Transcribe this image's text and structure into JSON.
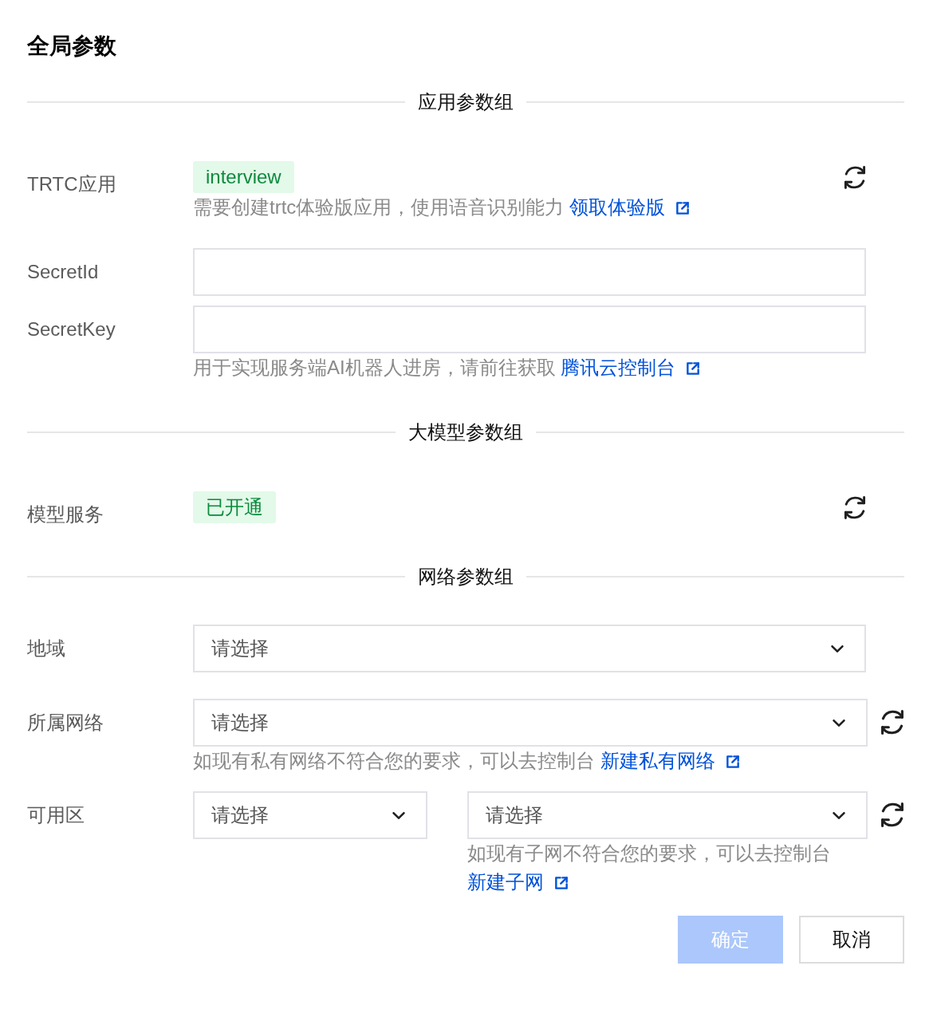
{
  "title": "全局参数",
  "sections": [
    {
      "title": "应用参数组",
      "fields": [
        {
          "kind": "tag",
          "label": "TRTC应用",
          "tag": "interview",
          "refresh": true,
          "help": {
            "text": "需要创建trtc体验版应用，使用语音识别能力",
            "link": "领取体验版"
          }
        },
        {
          "kind": "input",
          "label": "SecretId",
          "refresh": false
        },
        {
          "kind": "input",
          "label": "SecretKey",
          "refresh": false,
          "help": {
            "text": "用于实现服务端AI机器人进房，请前往获取",
            "link": "腾讯云控制台"
          }
        }
      ]
    },
    {
      "title": "大模型参数组",
      "fields": [
        {
          "kind": "tag",
          "label": "模型服务",
          "tag": "已开通",
          "refresh": true
        }
      ]
    },
    {
      "title": "网络参数组",
      "fields": [
        {
          "kind": "select",
          "label": "地域",
          "selects": [
            {
              "placeholder": "请选择"
            }
          ],
          "refresh": false
        },
        {
          "kind": "select",
          "label": "所属网络",
          "selects": [
            {
              "placeholder": "请选择"
            }
          ],
          "refresh": true,
          "help": {
            "text": "如现有私有网络不符合您的要求，可以去控制台",
            "link": "新建私有网络"
          }
        },
        {
          "kind": "select",
          "label": "可用区",
          "selects": [
            {
              "placeholder": "请选择"
            },
            {
              "placeholder": "请选择"
            }
          ],
          "refresh": true,
          "help": {
            "text": "如现有子网不符合您的要求，可以去控制台",
            "link": "新建子网"
          }
        }
      ]
    }
  ],
  "buttons": [
    {
      "label": "确定",
      "kind": "primary",
      "disabled": true
    },
    {
      "label": "取消",
      "kind": "default",
      "disabled": false
    }
  ]
}
